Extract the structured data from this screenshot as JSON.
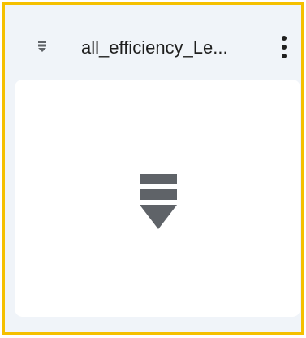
{
  "file": {
    "title": "all_efficiency_Le...",
    "type_icon": "tsv-file-icon",
    "menu_icon": "more-vert-icon"
  },
  "preview": {
    "icon": "tsv-file-large-icon"
  },
  "colors": {
    "frame_border": "#f5c000",
    "background": "#f0f4f9",
    "card": "#ffffff",
    "icon": "#5f6368"
  }
}
